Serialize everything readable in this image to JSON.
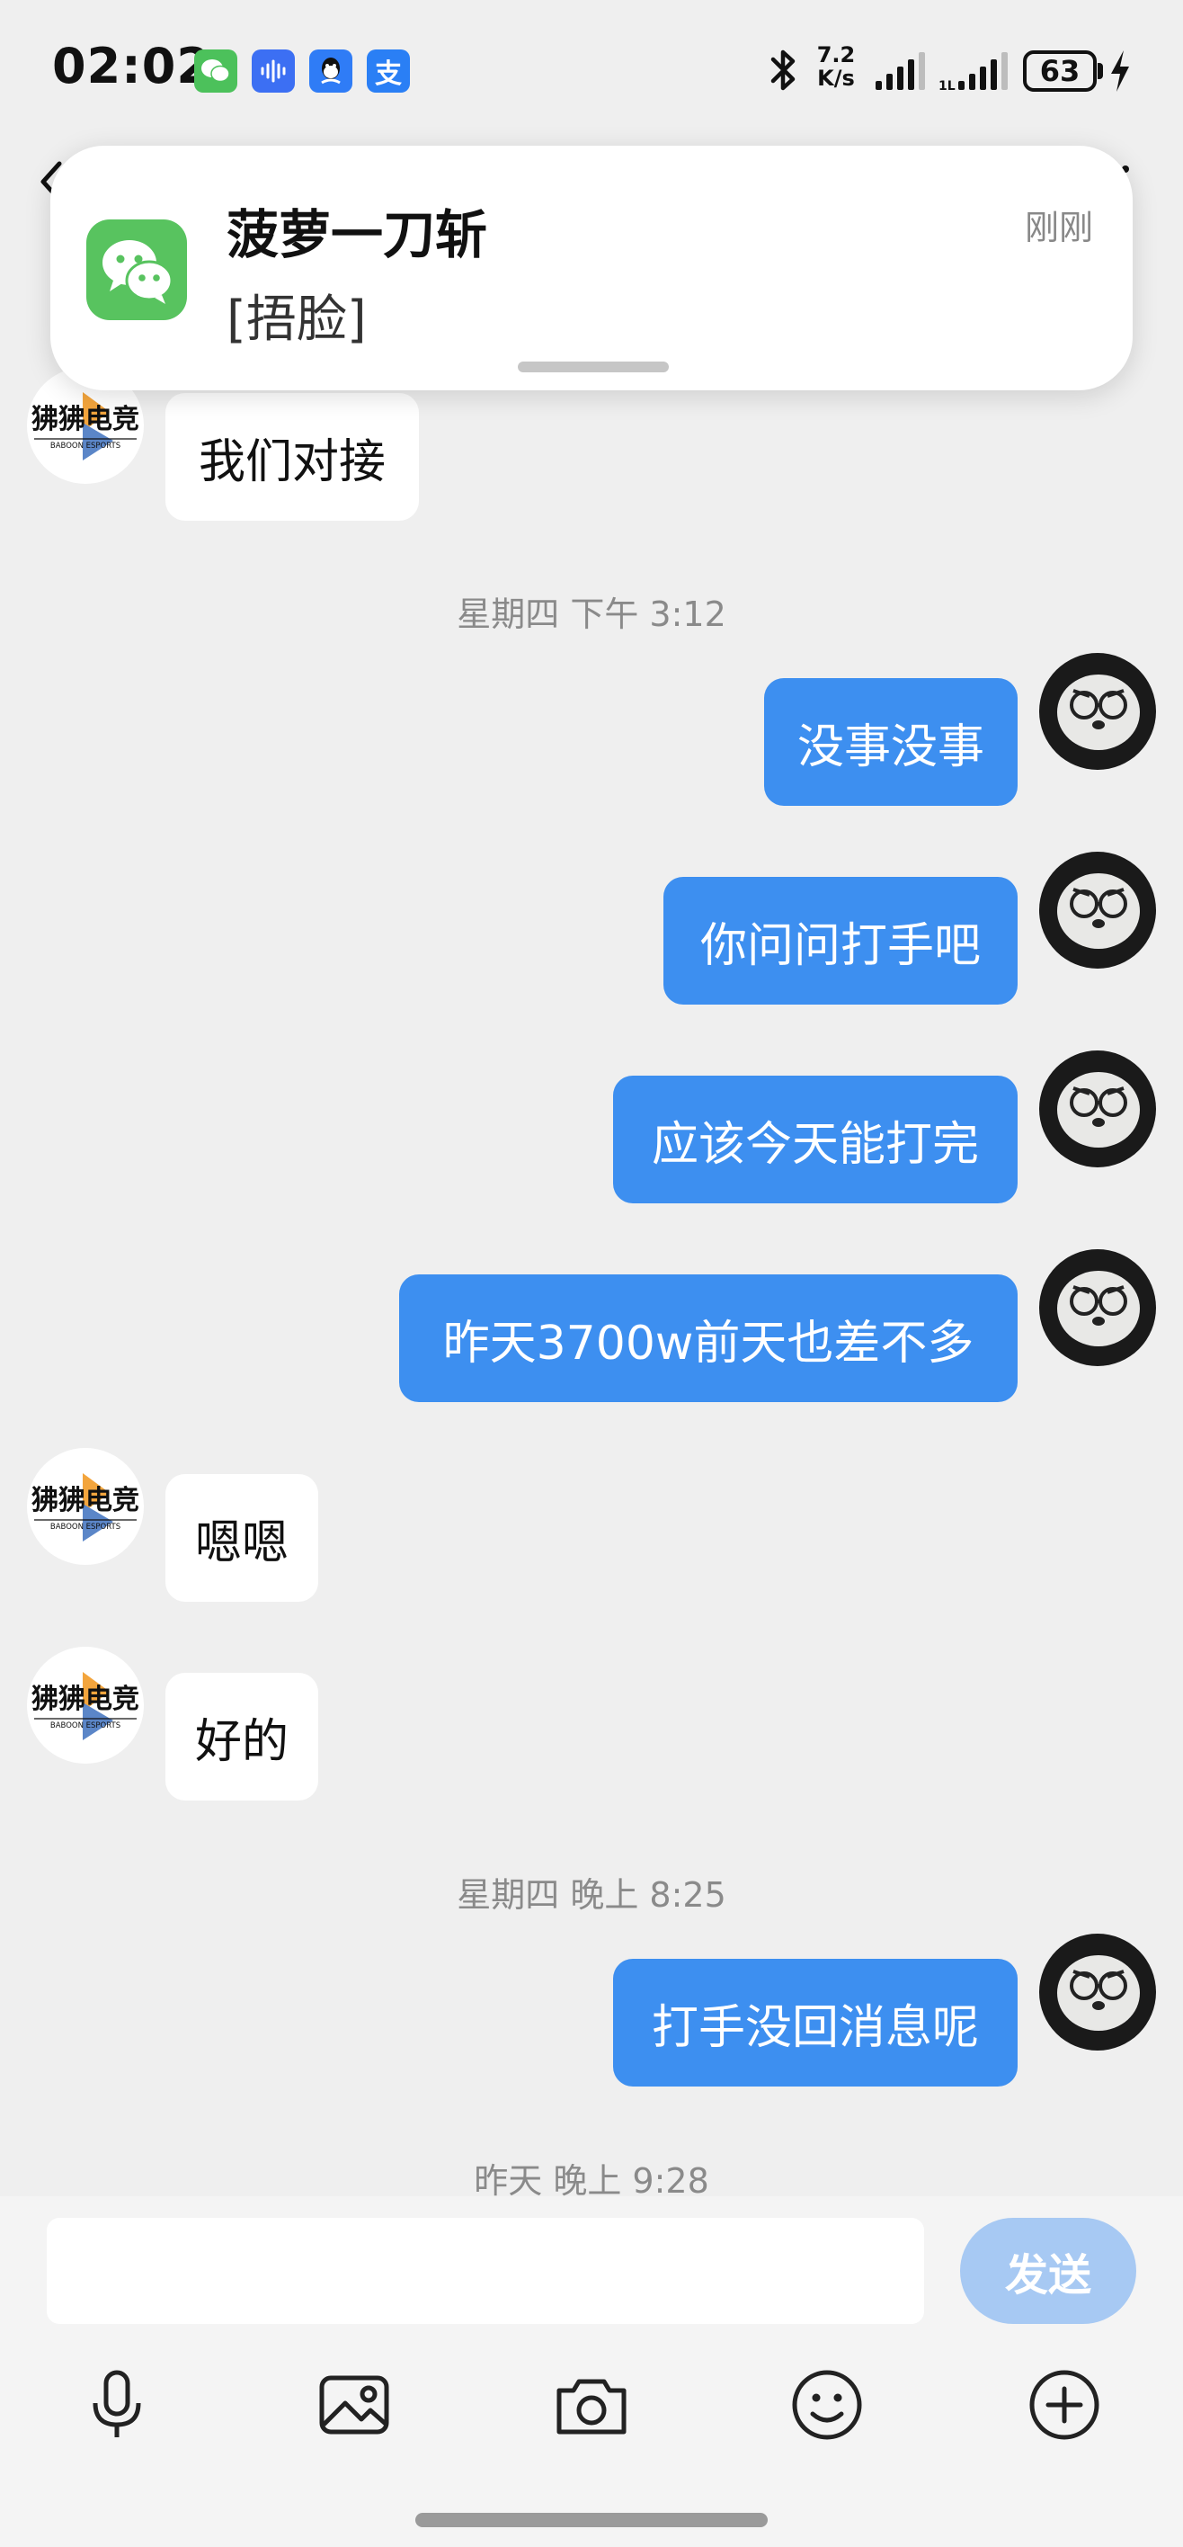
{
  "status_bar": {
    "time": "02:02",
    "net_speed_value": "7.2",
    "net_speed_unit": "K/s",
    "battery": "63"
  },
  "status_icons": [
    {
      "name": "wechat-icon",
      "color": "#4cc15b"
    },
    {
      "name": "voice-app-icon",
      "color": "#3c6ff3"
    },
    {
      "name": "qq-icon",
      "color": "#2f7cf6"
    },
    {
      "name": "alipay-icon",
      "color": "#2a7ff5",
      "glyph": "支"
    }
  ],
  "notification": {
    "title": "菠萝一刀斩",
    "text": "[捂脸]",
    "time": "刚刚"
  },
  "messages": [
    {
      "side": "in",
      "text": "我们对接"
    },
    {
      "type": "timestamp",
      "text": "星期四 下午 3:12"
    },
    {
      "side": "out",
      "text": "没事没事"
    },
    {
      "side": "out",
      "text": "你问问打手吧"
    },
    {
      "side": "out",
      "text": "应该今天能打完"
    },
    {
      "side": "out",
      "text": "昨天3700w前天也差不多"
    },
    {
      "side": "in",
      "text": "嗯嗯"
    },
    {
      "side": "in",
      "text": "好的"
    },
    {
      "type": "timestamp",
      "text": "星期四 晚上 8:25"
    },
    {
      "side": "out",
      "text": "打手没回消息呢"
    },
    {
      "type": "timestamp",
      "text": "昨天 晚上 9:28"
    }
  ],
  "contact_avatar": {
    "line1": "狒狒电竞",
    "line2": "BABOON ESPORTS"
  },
  "input": {
    "placeholder": "",
    "value": ""
  },
  "send_label": "发送",
  "toolbar": [
    "microphone-icon",
    "image-icon",
    "camera-icon",
    "emoji-icon",
    "plus-icon"
  ],
  "colors": {
    "outgoing_bubble": "#3d8ff0",
    "incoming_bubble": "#ffffff",
    "send_button": "#a7c9f3"
  }
}
